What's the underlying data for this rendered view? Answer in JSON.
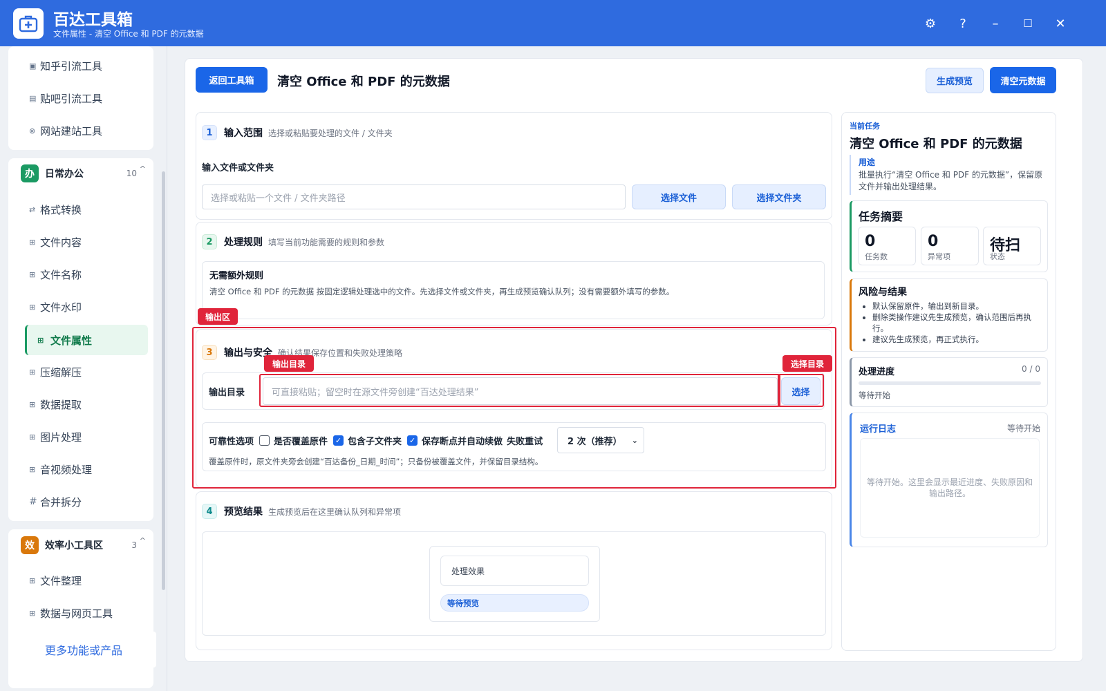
{
  "app": {
    "title": "百达工具箱",
    "subtitle": "文件属性 - 清空 Office 和 PDF 的元数据",
    "icon": "toolbox-icon"
  },
  "window_controls": {
    "settings": "⚙",
    "help": "?",
    "minimize": "–",
    "maximize": "☐",
    "close": "✕"
  },
  "sidebar": {
    "top_items": [
      {
        "icon": "▣",
        "label": "知乎引流工具"
      },
      {
        "icon": "▤",
        "label": "贴吧引流工具"
      },
      {
        "icon": "⊗",
        "label": "网站建站工具"
      }
    ],
    "group_daily": {
      "badge": "办",
      "badge_color": "#1b9a63",
      "title": "日常办公",
      "count": "10",
      "chevron": "^",
      "items": [
        {
          "icon": "⇄",
          "label": "格式转换"
        },
        {
          "icon": "⊞",
          "label": "文件内容"
        },
        {
          "icon": "⊞",
          "label": "文件名称"
        },
        {
          "icon": "⊞",
          "label": "文件水印"
        },
        {
          "icon": "⊞",
          "label": "文件属性"
        },
        {
          "icon": "⊞",
          "label": "压缩解压"
        },
        {
          "icon": "⊞",
          "label": "数据提取"
        },
        {
          "icon": "⊞",
          "label": "图片处理"
        },
        {
          "icon": "⊞",
          "label": "音视频处理"
        },
        {
          "icon": "#",
          "label": "合并拆分"
        }
      ],
      "active_index": 4
    },
    "group_efficiency": {
      "badge": "效",
      "badge_color": "#d9780b",
      "title": "效率小工具区",
      "count": "3",
      "chevron": "^",
      "items": [
        {
          "icon": "⊞",
          "label": "文件整理"
        },
        {
          "icon": "⊞",
          "label": "数据与网页工具"
        }
      ]
    },
    "more_label": "更多功能或产品"
  },
  "header": {
    "back_label": "返回工具箱",
    "title": "清空 Office 和 PDF 的元数据",
    "preview_label": "生成预览",
    "run_label": "清空元数据"
  },
  "section1": {
    "num": "1",
    "title": "输入范围",
    "desc": "选择或粘贴要处理的文件 / 文件夹",
    "field_label": "输入文件或文件夹",
    "placeholder": "选择或粘贴一个文件 / 文件夹路径",
    "choose_file": "选择文件",
    "choose_folder": "选择文件夹"
  },
  "section2": {
    "num": "2",
    "title": "处理规则",
    "desc": "填写当前功能需要的规则和参数",
    "rule_title": "无需额外规则",
    "rule_desc": "清空 Office 和 PDF 的元数据 按固定逻辑处理选中的文件。先选择文件或文件夹，再生成预览确认队列；没有需要额外填写的参数。"
  },
  "section3": {
    "num": "3",
    "title": "输出与安全",
    "desc": "确认结果保存位置和失败处理策略",
    "output_label": "输出目录",
    "output_placeholder": "可直接粘贴；留空时在源文件旁创建“百达处理结果”",
    "choose_label": "选择",
    "reliability_label": "可靠性选项",
    "opt_overwrite": "是否覆盖原件",
    "opt_overwrite_checked": false,
    "opt_subfolders": "包含子文件夹",
    "opt_subfolders_checked": true,
    "opt_resume": "保存断点并自动续做",
    "opt_resume_checked": true,
    "retry_label": "失败重试",
    "retry_value": "2 次（推荐）",
    "note": "覆盖原件时，原文件夹旁会创建“百达备份_日期_时间”；只备份被覆盖文件，并保留目录结构。"
  },
  "annotations": {
    "output_zone": "输出区",
    "output_dir": "输出目录",
    "choose_dir": "选择目录"
  },
  "section4": {
    "num": "4",
    "title": "预览结果",
    "desc": "生成预览后在这里确认队列和异常项",
    "effect_label": "处理效果",
    "status_label": "等待预览"
  },
  "right": {
    "current_task_label": "当前任务",
    "task_title": "清空 Office 和 PDF 的元数据",
    "purpose_label": "用途",
    "purpose_text": "批量执行“清空 Office 和 PDF 的元数据”，保留原文件并输出处理结果。",
    "summary_title": "任务摘要",
    "stats": [
      {
        "value": "0",
        "label": "任务数"
      },
      {
        "value": "0",
        "label": "异常项"
      },
      {
        "value": "待扫",
        "label": "状态"
      }
    ],
    "risk_title": "风险与结果",
    "risks": [
      "默认保留原件，输出到新目录。",
      "删除类操作建议先生成预览，确认范围后再执行。",
      "建议先生成预览，再正式执行。"
    ],
    "progress_title": "处理进度",
    "progress_count": "0 / 0",
    "progress_fraction": 0,
    "progress_status": "等待开始",
    "log_title": "运行日志",
    "log_status": "等待开始",
    "log_placeholder": "等待开始。这里会显示最近进度、失败原因和输出路径。"
  }
}
